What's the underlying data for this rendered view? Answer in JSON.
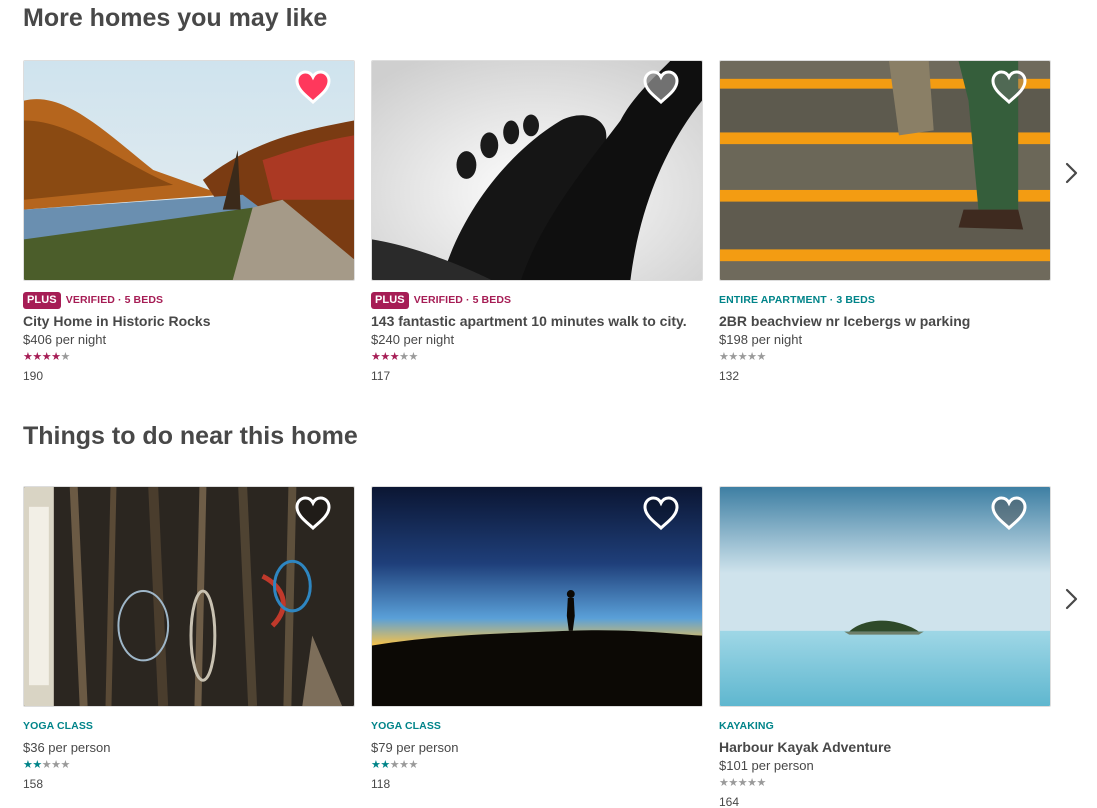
{
  "homes": {
    "title": "More homes you may like",
    "next_icon": "chevron-right-icon",
    "cards": [
      {
        "plus_badge": "PLUS",
        "meta": "VERIFIED · 5 BEDS",
        "meta_color": "#a61d55",
        "title": "City Home in Historic Rocks",
        "price": "$406 per night",
        "rating": 4,
        "star_color": "#a61d55",
        "reviews": "190",
        "saved": true,
        "photo": "autumn-lake-road"
      },
      {
        "plus_badge": "PLUS",
        "meta": "VERIFIED · 5 BEDS",
        "meta_color": "#a61d55",
        "title": "143 fantastic apartment 10 minutes walk to city.",
        "price": "$240 per night",
        "rating": 2.5,
        "star_color": "#a61d55",
        "reviews": "117",
        "saved": false,
        "photo": "bare-feet-bw"
      },
      {
        "plus_badge": "",
        "meta": "ENTIRE APARTMENT · 3 BEDS",
        "meta_color": "#008489",
        "title": "2BR beachview nr Icebergs w parking",
        "price": "$198 per night",
        "rating": 0,
        "star_color": "#888888",
        "reviews": "132",
        "saved": false,
        "photo": "orange-stairs"
      }
    ]
  },
  "things": {
    "title": "Things to do near this home",
    "next_icon": "chevron-right-icon",
    "cards": [
      {
        "meta": "YOGA CLASS",
        "meta_color": "#008489",
        "title": "",
        "price": "$36 per person",
        "rating": 2,
        "star_color": "#008489",
        "reviews": "158",
        "saved": false,
        "photo": "climbing-gear"
      },
      {
        "meta": "YOGA CLASS",
        "meta_color": "#008489",
        "title": "",
        "price": "$79 per person",
        "rating": 2,
        "star_color": "#008489",
        "reviews": "118",
        "saved": false,
        "photo": "sunset-silhouette"
      },
      {
        "meta": "KAYAKING",
        "meta_color": "#008489",
        "title": "Harbour Kayak Adventure",
        "price": "$101 per person",
        "rating": 0,
        "star_color": "#888888",
        "reviews": "164",
        "saved": false,
        "photo": "island-sea"
      }
    ]
  }
}
